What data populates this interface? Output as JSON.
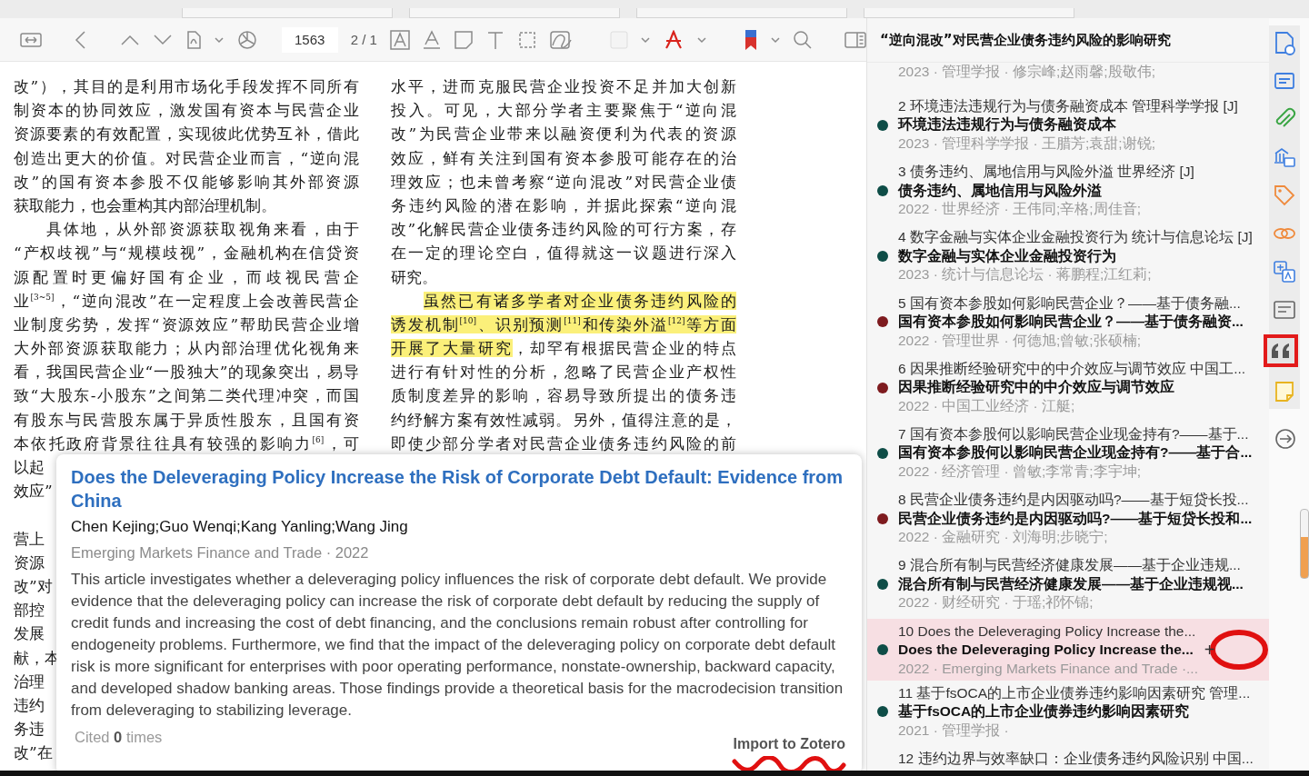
{
  "toolbar": {
    "page_input": "1563",
    "page_count": "2 / 1"
  },
  "document": {
    "columns": [
      {
        "lines": [
          {
            "kind": "body",
            "text": "改”），其目的是利用市场化手段发挥不同所有"
          },
          {
            "kind": "body",
            "text": "制资本的协同效应，激发国有资本与民营企业"
          },
          {
            "kind": "body",
            "text": "资源要素的有效配置，实现彼此优势互补，借此"
          },
          {
            "kind": "body",
            "text": "创造出更大的价值。对民营企业而言，“逆向混"
          },
          {
            "kind": "body",
            "text": "改”的国有资本参股不仅能够影响其外部资源"
          },
          {
            "kind": "end",
            "text": "获取能力，也会重构其内部治理机制。"
          },
          {
            "kind": "indent",
            "text": "具体地，从外部资源获取视角来看，由于"
          },
          {
            "kind": "body",
            "text": "“产权歧视”与“规模歧视”，金融机构在信贷资"
          },
          {
            "kind": "body",
            "text": "源配置时更偏好国有企业，而歧视民营企"
          },
          {
            "kind": "body",
            "text": "业$^{[3~5]}$，“逆向混改”在一定程度上会改善民营企"
          },
          {
            "kind": "body",
            "text": "业制度劣势，发挥“资源效应”帮助民营企业增"
          },
          {
            "kind": "body",
            "text": "大外部资源获取能力；从内部治理优化视角来"
          },
          {
            "kind": "body",
            "text": "看，我国民营企业“一股独大”的现象突出，易导"
          },
          {
            "kind": "body",
            "text": "致“大股东-小股东”之间第二类代理冲突，而国"
          },
          {
            "kind": "body",
            "text": "有股东与民营股东属于异质性股东，且国有资"
          },
          {
            "kind": "body",
            "text": "本依托政府背景往往具有较强的影响力$^{[6]}$，可"
          },
          {
            "kind": "fragment",
            "text": "以起"
          },
          {
            "kind": "fragment",
            "text": "效应”"
          },
          {
            "kind": "gap"
          },
          {
            "kind": "fragment",
            "text": "营上"
          },
          {
            "kind": "fragment",
            "text": "资源"
          },
          {
            "kind": "fragment",
            "text": "改”对"
          },
          {
            "kind": "fragment",
            "text": "部控"
          },
          {
            "kind": "fragment",
            "text": "发展"
          },
          {
            "kind": "fragment",
            "text": "献，本"
          },
          {
            "kind": "fragment",
            "text": "治理"
          },
          {
            "kind": "fragment",
            "text": "违约"
          },
          {
            "kind": "fragment",
            "text": "务违"
          },
          {
            "kind": "fragment",
            "text": "改”在"
          }
        ]
      },
      {
        "lines": [
          {
            "kind": "body",
            "text": "水平，进而克服民营企业投资不足并加大创新"
          },
          {
            "kind": "body",
            "text": "投入。可见，大部分学者主要聚焦于“逆向混"
          },
          {
            "kind": "body",
            "text": "改”为民营企业带来以融资便利为代表的资源"
          },
          {
            "kind": "body",
            "text": "效应，鲜有关注到国有资本参股可能存在的治"
          },
          {
            "kind": "body",
            "text": "理效应；也未曾考察“逆向混改”对民营企业债"
          },
          {
            "kind": "body",
            "text": "务违约风险的潜在影响，并据此探索“逆向混"
          },
          {
            "kind": "body",
            "text": "改”化解民营企业债务违约风险的可行方案，存"
          },
          {
            "kind": "body",
            "text": "在一定的理论空白，值得就这一议题进行深入"
          },
          {
            "kind": "end",
            "text": "研究。"
          },
          {
            "kind": "indent",
            "segments": [
              {
                "text": "虽然已有诸多学者对企业债务违约风险的",
                "highlighted": true
              }
            ]
          },
          {
            "kind": "body",
            "segments": [
              {
                "text": "诱发机制$^{[10]}$、识别预测$^{[11]}$和传染外溢$^{[12]}$等方面",
                "highlighted": true
              }
            ]
          },
          {
            "kind": "body",
            "segments": [
              {
                "text": "开展了大量研究",
                "highlighted": true
              },
              {
                "text": "，却罕有根据民营企业的特点",
                "highlighted": false
              }
            ]
          },
          {
            "kind": "body",
            "text": "进行有针对性的分析，忽略了民营企业产权性"
          },
          {
            "kind": "body",
            "text": "质制度差异的影响，容易导致所提出的债务违"
          },
          {
            "kind": "body",
            "text": "约纾解方案有效性减弱。另外，值得注意的是，"
          },
          {
            "kind": "body",
            "text": "即使少部分学者对民营企业债务违约风险的前"
          }
        ]
      }
    ]
  },
  "popup": {
    "title": "Does the Deleveraging Policy Increase the Risk of Corporate Debt Default: Evidence from China",
    "authors": "Chen Kejing;Guo Wenqi;Kang Yanling;Wang Jing",
    "source": "Emerging Markets Finance and Trade · 2022",
    "abstract": "This article investigates whether a deleveraging policy influences the risk of corporate debt default. We provide evidence that the deleveraging policy can increase the risk of corporate debt default by reducing the supply of credit funds and increasing the cost of debt financing, and the conclusions remain robust after controlling for endogeneity problems. Furthermore, we find that the impact of the deleveraging policy on corporate debt default risk is more significant for enterprises with poor operating performance, nonstate-ownership, backward capacity, and developed shadow banking areas. Those findings provide a theoretical basis for the macrodecision transition from deleveraging to stabilizing leverage.",
    "cited": "Cited **0** times",
    "import_button": {
      "label": "Import to Zotero",
      "scribbled": true
    }
  },
  "panel": {
    "title": "“逆向混改”对民营企业债务违约风险的影响研究",
    "items": [
      {
        "meta": "2023 · 管理学报 · 修宗峰;赵雨馨;殷敬伟;",
        "selected": false
      },
      {
        "heading": "2 环境违法违规行为与债务融资成本 管理科学学报 [J]",
        "title": "环境违法违规行为与债务融资成本",
        "meta": "2023 · 管理科学学报 · 王腊芳;袁甜;谢锐;",
        "color": "#0e4d47",
        "selected": false
      },
      {
        "heading": "3 债务违约、属地信用与风险外溢 世界经济 [J]",
        "title": "债务违约、属地信用与风险外溢",
        "meta": "2022 · 世界经济 · 王伟同;辛格;周佳音;",
        "color": "#0e4d47",
        "selected": false
      },
      {
        "heading": "4 数字金融与实体企业金融投资行为 统计与信息论坛 [J]",
        "title": "数字金融与实体企业金融投资行为",
        "meta": "2023 · 统计与信息论坛 · 蒋鹏程;江红莉;",
        "color": "#0e4d47",
        "selected": false
      },
      {
        "heading": "5 国有资本参股如何影响民营企业？——基于债务融...",
        "title": "国有资本参股如何影响民营企业？——基于债务融资...",
        "meta": "2022 · 管理世界 · 何德旭;曾敏;张硕楠;",
        "color": "#7e1b1f",
        "selected": false
      },
      {
        "heading": "6 因果推断经验研究中的中介效应与调节效应 中国工...",
        "title": "因果推断经验研究中的中介效应与调节效应",
        "meta": "2022 · 中国工业经济 · 江艇;",
        "color": "#7e1b1f",
        "selected": false
      },
      {
        "heading": "7 国有资本参股何以影响民营企业现金持有?——基于...",
        "title": "国有资本参股何以影响民营企业现金持有?——基于合...",
        "meta": "2022 · 经济管理 · 曾敏;李常青;李宇坤;",
        "color": "#0e4d47",
        "selected": false
      },
      {
        "heading": "8 民营企业债务违约是内因驱动吗?——基于短贷长投...",
        "title": "民营企业债务违约是内因驱动吗?——基于短贷长投和...",
        "meta": "2022 · 金融研究 · 刘海明;步晓宁;",
        "color": "#7e1b1f",
        "selected": false
      },
      {
        "heading": "9 混合所有制与民营经济健康发展——基于企业违规...",
        "title": "混合所有制与民营经济健康发展——基于企业违规视...",
        "meta": "2022 · 财经研究 · 于瑶;祁怀锦;",
        "color": "#0e4d47",
        "selected": false
      },
      {
        "heading": "10 Does the Deleveraging Policy Increase the...",
        "title": "Does the Deleveraging Policy Increase the...",
        "meta": "2022 · Emerging Markets Finance and Trade ·...",
        "color": "#0e4d47",
        "selected": true,
        "add": {
          "label": "+",
          "circled": true
        }
      },
      {
        "heading": "11 基于fsOCA的上市企业债券违约影响因素研究 管理...",
        "title": "基于fsOCA的上市企业债券违约影响因素研究",
        "meta": "2021 · 管理学报 ·",
        "color": "#0e4d47",
        "selected": false
      },
      {
        "heading": "12 违约边界与效率缺口：企业债务违约风险识别 中国...",
        "selected": false
      }
    ]
  },
  "rail": [
    {
      "kind": "info",
      "outlined": false
    },
    {
      "kind": "card",
      "outlined": false
    },
    {
      "kind": "clip",
      "outlined": false
    },
    {
      "kind": "library",
      "outlined": false
    },
    {
      "kind": "tag",
      "outlined": false
    },
    {
      "kind": "link",
      "outlined": false
    },
    {
      "kind": "translate",
      "outlined": false
    },
    {
      "kind": "lines",
      "outlined": false
    },
    {
      "kind": "quote",
      "outlined": true
    },
    {
      "kind": "note",
      "outlined": false
    },
    {
      "kind": "export",
      "outlined": false
    }
  ]
}
